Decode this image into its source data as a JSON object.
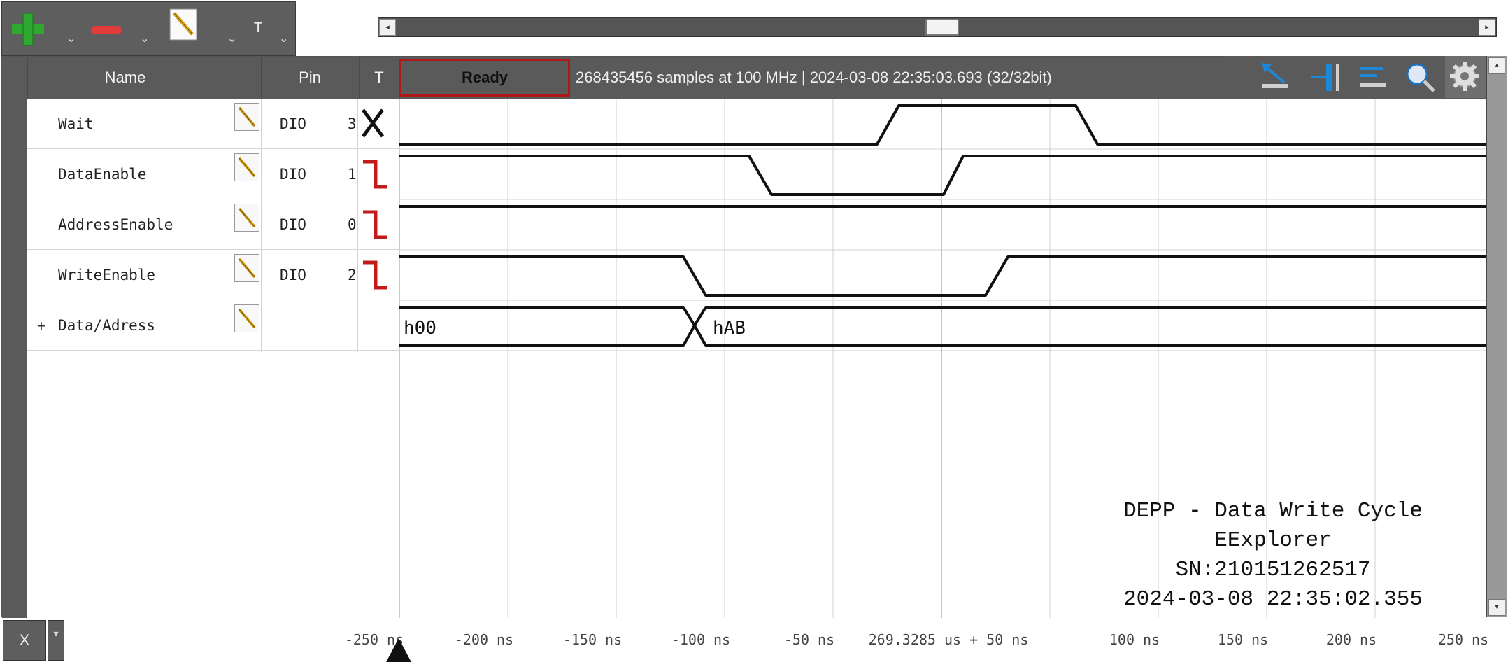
{
  "toolbar": {
    "add_caret": "⌄",
    "remove_caret": "⌄",
    "edit_caret": "⌄",
    "text_label": "T",
    "text_caret": "⌄"
  },
  "scrollbar": {
    "left_arrow": "◂",
    "right_arrow": "▸",
    "up_arrow": "▴",
    "down_arrow": "▾"
  },
  "header": {
    "name": "Name",
    "pin": "Pin",
    "trigger": "T",
    "status": "Ready",
    "info": "268435456 samples at 100 MHz | 2024-03-08 22:35:03.693 (32/32bit)"
  },
  "rows": [
    {
      "prefix": "",
      "name": "Wait",
      "pin": "DIO",
      "pin_num": "3",
      "trigger": "X"
    },
    {
      "prefix": "",
      "name": "DataEnable",
      "pin": "DIO",
      "pin_num": "1",
      "trigger": "falling"
    },
    {
      "prefix": "",
      "name": "AddressEnable",
      "pin": "DIO",
      "pin_num": "0",
      "trigger": "falling"
    },
    {
      "prefix": "",
      "name": "WriteEnable",
      "pin": "DIO",
      "pin_num": "2",
      "trigger": "falling"
    },
    {
      "prefix": "+",
      "name": "Data/Adress",
      "pin": "",
      "pin_num": "",
      "trigger": ""
    }
  ],
  "bus_values": [
    "h00",
    "hAB"
  ],
  "watermark": {
    "line1": "DEPP - Data Write Cycle",
    "line2": "EExplorer",
    "line3": "SN:210151262517",
    "line4": "2024-03-08 22:35:02.355"
  },
  "axis": {
    "x_button": "X",
    "x_caret": "▾",
    "ticks": [
      "-250 ns",
      "-200 ns",
      "-150 ns",
      "-100 ns",
      "-50 ns",
      "269.3285 us + 50 ns",
      "100 ns",
      "150 ns",
      "200 ns",
      "250 ns"
    ]
  },
  "colors": {
    "trigger_red": "#c41a1a",
    "status_border": "#b01818",
    "add_green": "#2ea82e",
    "tool_blue": "#1e88d8"
  },
  "icons": {
    "add": "plus-icon",
    "remove": "minus-icon",
    "edit": "pencil-icon",
    "settings": "gear-icon",
    "zoom": "magnifier-icon"
  }
}
